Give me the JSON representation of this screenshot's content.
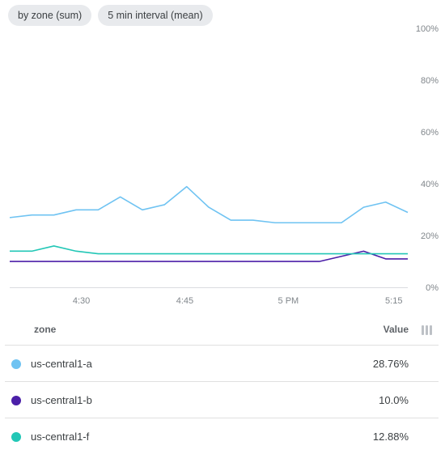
{
  "chips": [
    {
      "label": "by zone (sum)"
    },
    {
      "label": "5 min interval (mean)"
    }
  ],
  "legend": {
    "headers": {
      "name": "zone",
      "value": "Value"
    },
    "rows": [
      {
        "name": "us-central1-a",
        "value": "28.76%",
        "color": "#6fc3f2"
      },
      {
        "name": "us-central1-b",
        "value": "10.0%",
        "color": "#4b1fa8"
      },
      {
        "name": "us-central1-f",
        "value": "12.88%",
        "color": "#22c7b6"
      }
    ]
  },
  "chart_data": {
    "type": "line",
    "ylim": [
      0,
      100
    ],
    "y_unit": "%",
    "y_ticks": [
      0,
      20,
      40,
      60,
      80,
      100
    ],
    "x_labels": [
      {
        "pos": 0.18,
        "text": "4:30"
      },
      {
        "pos": 0.44,
        "text": "4:45"
      },
      {
        "pos": 0.7,
        "text": "5 PM"
      },
      {
        "pos": 0.965,
        "text": "5:15"
      }
    ],
    "x": [
      0,
      1,
      2,
      3,
      4,
      5,
      6,
      7,
      8,
      9,
      10,
      11,
      12,
      13,
      14,
      15,
      16,
      17
    ],
    "series": [
      {
        "name": "us-central1-a",
        "color": "#6fc3f2",
        "values": [
          27,
          28,
          28,
          30,
          30,
          35,
          30,
          32,
          39,
          31,
          26,
          26,
          25,
          25,
          25,
          25,
          31,
          33,
          29
        ]
      },
      {
        "name": "us-central1-b",
        "color": "#4b1fa8",
        "values": [
          10,
          10,
          10,
          10,
          10,
          10,
          10,
          10,
          10,
          10,
          10,
          10,
          10,
          10,
          10,
          12,
          14,
          11,
          11
        ]
      },
      {
        "name": "us-central1-f",
        "color": "#22c7b6",
        "values": [
          14,
          14,
          16,
          14,
          13,
          13,
          13,
          13,
          13,
          13,
          13,
          13,
          13,
          13,
          13,
          13,
          13,
          13,
          13
        ]
      }
    ]
  }
}
